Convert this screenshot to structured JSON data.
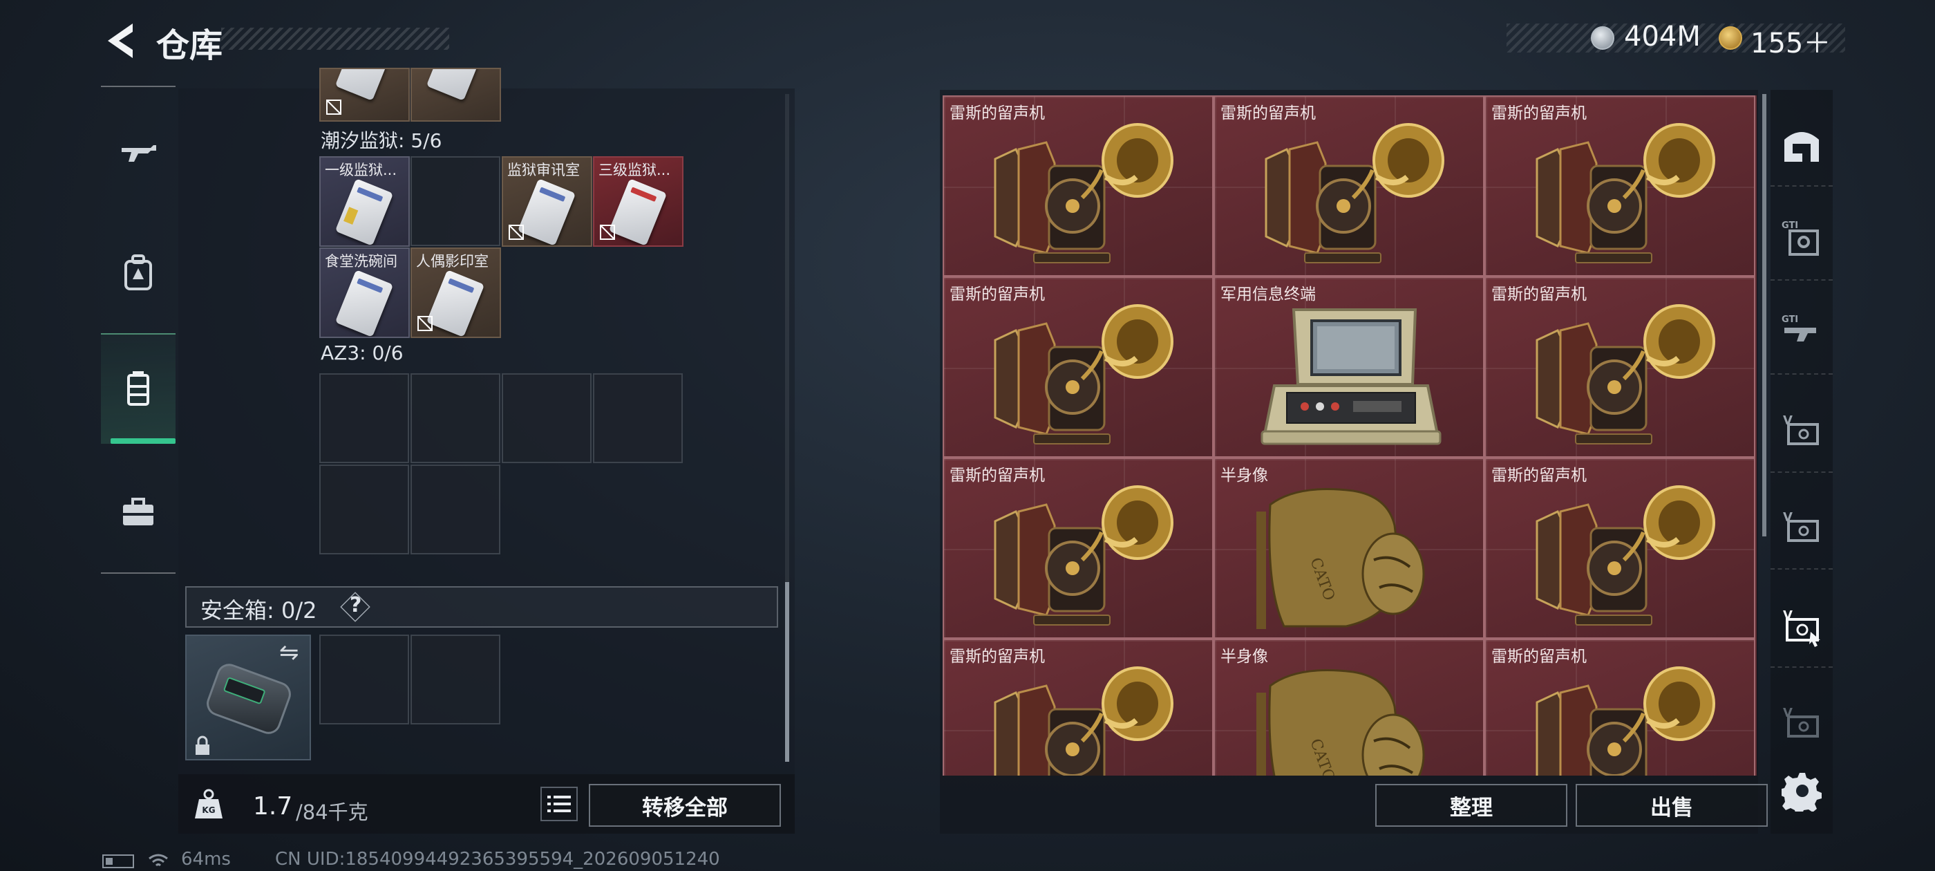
{
  "header": {
    "title": "仓库",
    "currency1": "404M",
    "currency2": "155＋"
  },
  "sidebar": {
    "tabs": [
      "weapon",
      "backpack",
      "warehouse",
      "toolbox"
    ],
    "active": "warehouse"
  },
  "left": {
    "top_section_partial": true,
    "sec1": {
      "label": "潮汐监狱: 5/6",
      "items": [
        {
          "label": "一级监狱...",
          "style": "purple",
          "no_insure": false
        },
        {
          "label": "",
          "style": "empty"
        },
        {
          "label": "监狱审讯室",
          "style": "brown",
          "no_insure": true
        },
        {
          "label": "三级监狱...",
          "style": "red",
          "no_insure": true
        },
        {
          "label": "食堂洗碗间",
          "style": "purple",
          "no_insure": false
        },
        {
          "label": "人偶影印室",
          "style": "brown",
          "no_insure": true
        }
      ]
    },
    "sec2": {
      "label": "AZ3: 0/6"
    },
    "safe": {
      "label": "安全箱: 0/2",
      "help": "?"
    }
  },
  "weight": {
    "current": "1.7",
    "capacity": "/84千克",
    "transfer_all": "转移全部"
  },
  "right": {
    "items": [
      {
        "label": "雷斯的留声机",
        "icon": "gramophone"
      },
      {
        "label": "雷斯的留声机",
        "icon": "gramophone"
      },
      {
        "label": "雷斯的留声机",
        "icon": "gramophone"
      },
      {
        "label": "雷斯的留声机",
        "icon": "gramophone"
      },
      {
        "label": "军用信息终端",
        "icon": "terminal"
      },
      {
        "label": "雷斯的留声机",
        "icon": "gramophone"
      },
      {
        "label": "雷斯的留声机",
        "icon": "gramophone"
      },
      {
        "label": "半身像",
        "icon": "bust"
      },
      {
        "label": "雷斯的留声机",
        "icon": "gramophone"
      },
      {
        "label": "雷斯的留声机",
        "icon": "gramophone"
      },
      {
        "label": "半身像",
        "icon": "bust"
      },
      {
        "label": "雷斯的留声机",
        "icon": "gramophone"
      }
    ],
    "sort": "整理",
    "sell": "出售"
  },
  "rail": {
    "tabs": [
      "all-icon",
      "gti-tag-icon",
      "gti-gun-icon",
      "v-tag-icon",
      "v-tag-icon",
      "v-tag-cursor-icon",
      "v-tag-icon"
    ],
    "active_index": 5
  },
  "status": {
    "ping": "64ms",
    "uid": "CN UID:18540994492365395594_202609051240"
  }
}
